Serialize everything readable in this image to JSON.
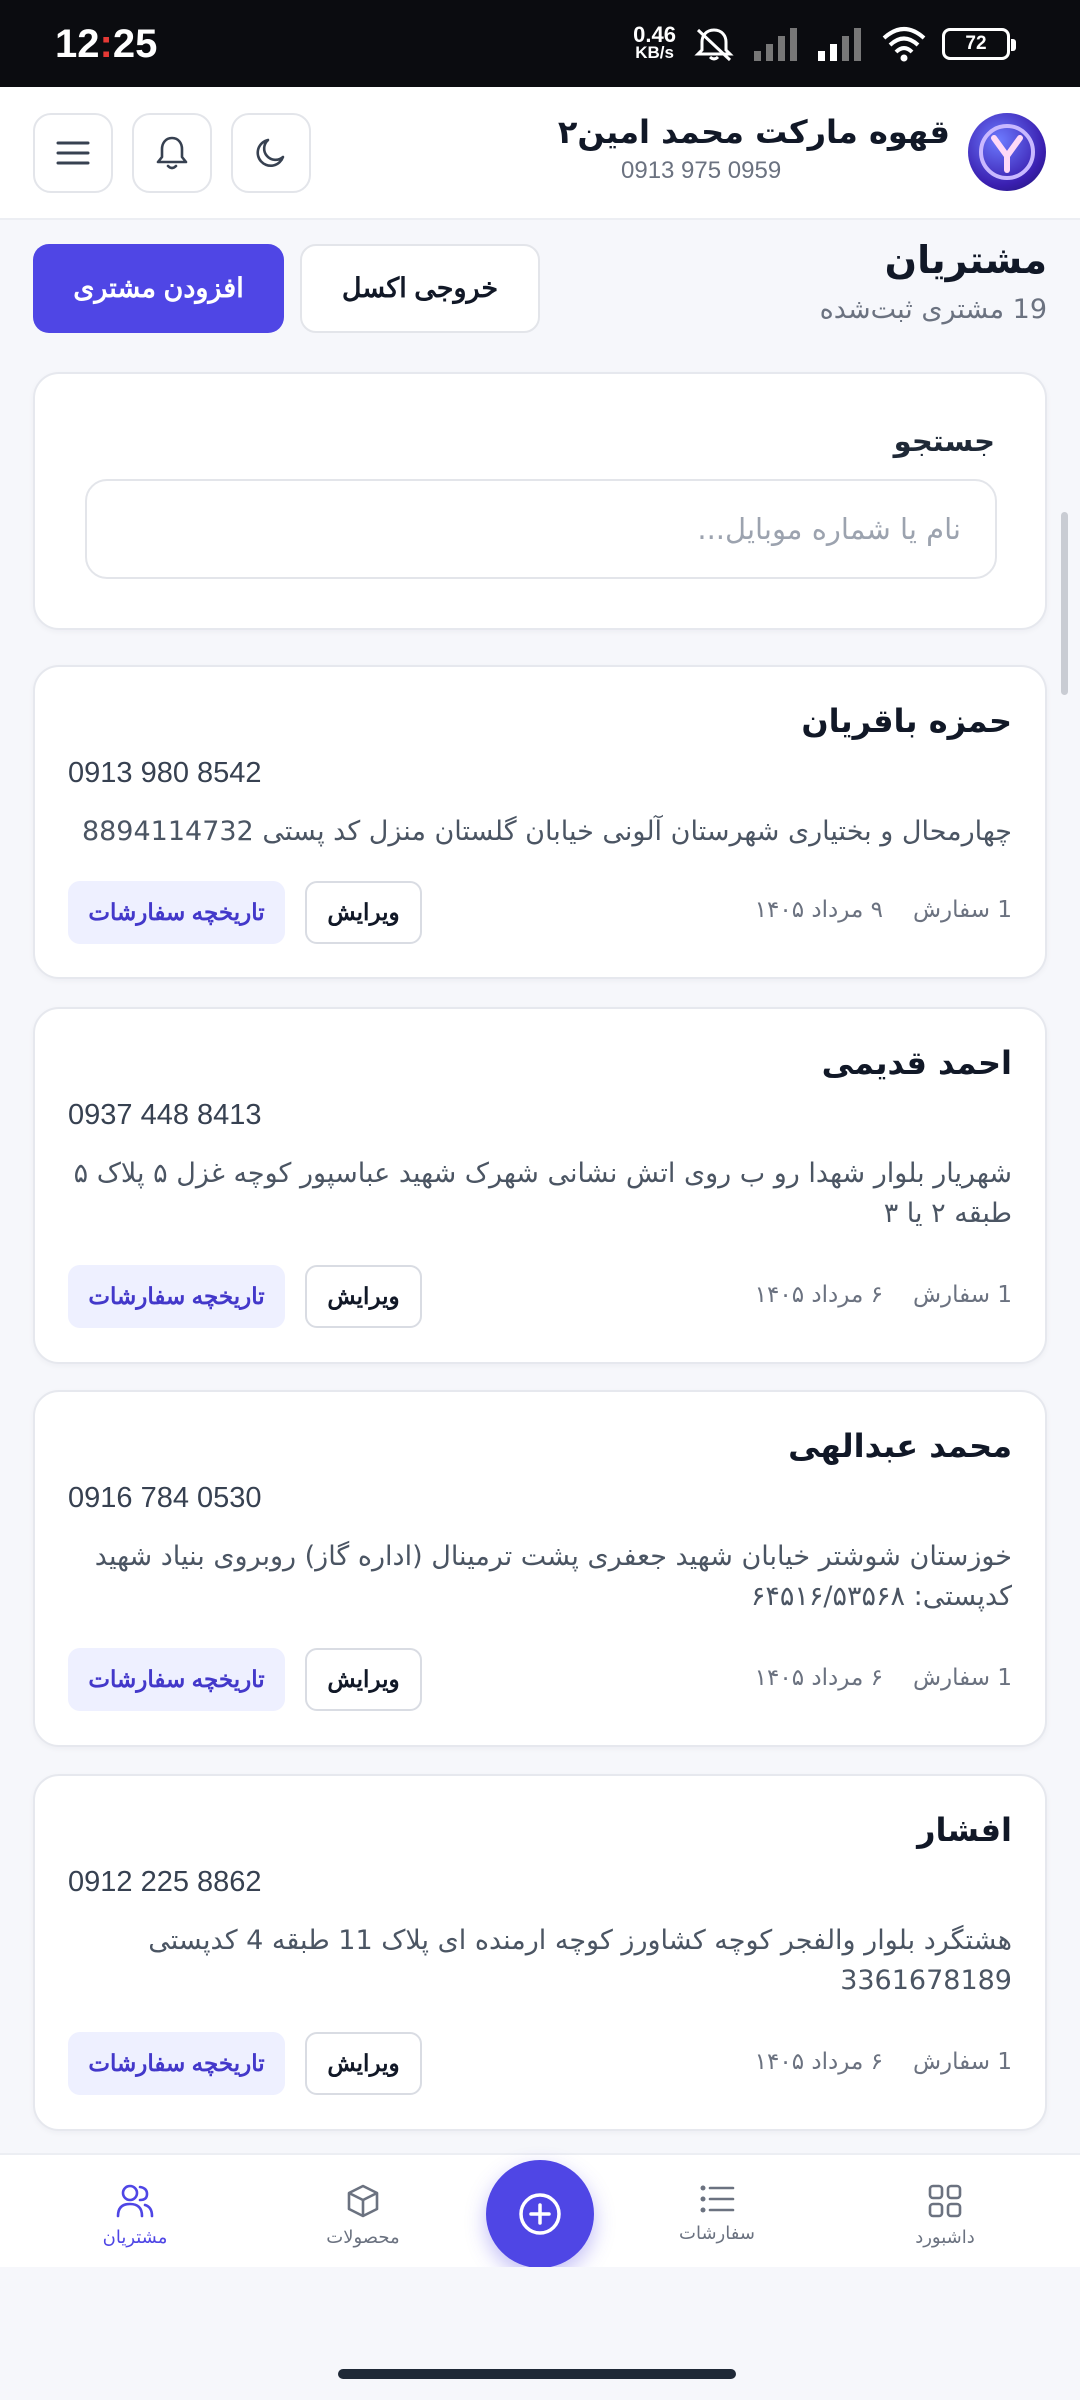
{
  "status_bar": {
    "time_hour": "12",
    "time_sep": ":",
    "time_min": "25",
    "speed_value": "0.46",
    "speed_unit": "KB/s",
    "battery": "72"
  },
  "header": {
    "store_name": "قهوه مارکت محمد امین۲",
    "store_phone": "0913 975 0959"
  },
  "page": {
    "title": "مشتریان",
    "subtitle": "19 مشتری ثبت‌شده",
    "add_customer_label": "افزودن مشتری",
    "export_excel_label": "خروجی اکسل"
  },
  "search": {
    "label": "جستجو",
    "placeholder": "نام یا شماره موبایل..."
  },
  "actions": {
    "history_label": "تاریخچه سفارشات",
    "edit_label": "ویرایش"
  },
  "customers": [
    {
      "name": "حمزه باقریان",
      "phone": "0913 980 8542",
      "address": "چهارمحال و بختیاری شهرستان آلونی خیابان گلستان منزل کد پستی 8894114732",
      "orders": "1 سفارش",
      "date": "۹ مرداد ۱۴۰۵"
    },
    {
      "name": "احمد قدیمی",
      "phone": "0937 448 8413",
      "address": "شهریار بلوار شهدا رو ب روی اتش نشانی شهرک شهید عباسپور کوچه غزل ۵ پلاک ۵ طبقه ۲ یا ۳",
      "orders": "1 سفارش",
      "date": "۶ مرداد ۱۴۰۵"
    },
    {
      "name": "محمد عبدالهی",
      "phone": "0916 784 0530",
      "address": "خوزستان شوشتر خیابان شهید جعفری پشت ترمینال (اداره گاز) روبروی بنیاد شهید کدپستی: ۶۴۵۱۶/۵۳۵۶۸",
      "orders": "1 سفارش",
      "date": "۶ مرداد ۱۴۰۵"
    },
    {
      "name": "افشار",
      "phone": "0912 225 8862",
      "address": "هشتگرد بلوار والفجر کوچه کشاورز کوچه ارمنده ای پلاک 11 طبقه 4 کدپستی 3361678189",
      "orders": "1 سفارش",
      "date": "۶ مرداد ۱۴۰۵"
    }
  ],
  "bottom_nav": {
    "customers": "مشتریان",
    "products": "محصولات",
    "orders": "سفارشات",
    "dashboard": "داشبورد"
  },
  "colors": {
    "accent": "#4f46e5",
    "accent_soft": "#eef0ff",
    "background": "#f6f7fb",
    "status_bar": "#0b0c10"
  }
}
